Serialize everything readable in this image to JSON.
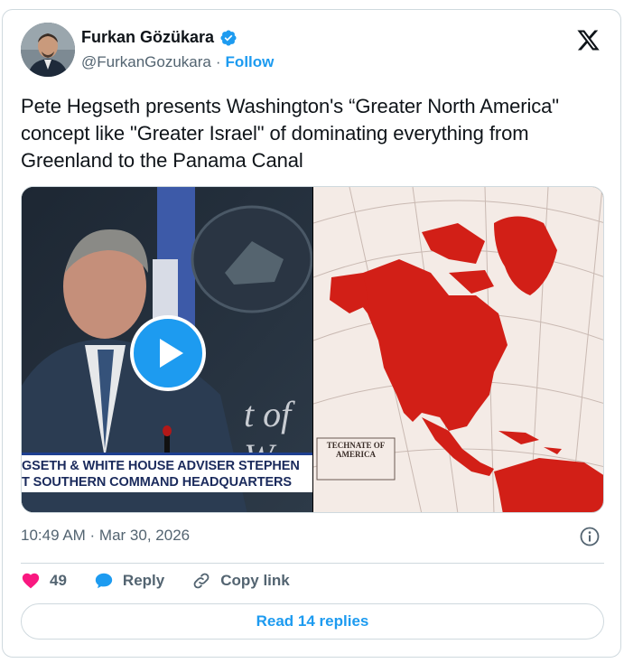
{
  "author": {
    "display_name": "Furkan Gözükara",
    "handle": "@FurkanGozukara",
    "separator": "·",
    "follow_label": "Follow",
    "verified": true
  },
  "tweet": {
    "text": "Pete Hegseth presents Washington's “Greater North America\" concept like \"Greater Israel\" of dominating everything from Greenland to the Panama Canal",
    "timestamp": "10:49 AM · Mar 30, 2026"
  },
  "media": {
    "video_ticker_line1": "GSETH & WHITE HOUSE ADVISER STEPHEN",
    "video_ticker_line2": "T SOUTHERN COMMAND HEADQUARTERS",
    "video_backdrop_text": "t of W",
    "map_title": "TECHNATE OF AMERICA"
  },
  "actions": {
    "like_count": "49",
    "reply_label": "Reply",
    "copy_link_label": "Copy link"
  },
  "footer": {
    "read_replies_label": "Read 14 replies"
  },
  "colors": {
    "accent": "#1d9bf0",
    "like": "#f91880",
    "map_red": "#d21f17"
  },
  "icons": [
    "verified-badge-icon",
    "x-logo-icon",
    "play-icon",
    "info-icon",
    "heart-icon",
    "reply-bubble-icon",
    "link-icon"
  ]
}
